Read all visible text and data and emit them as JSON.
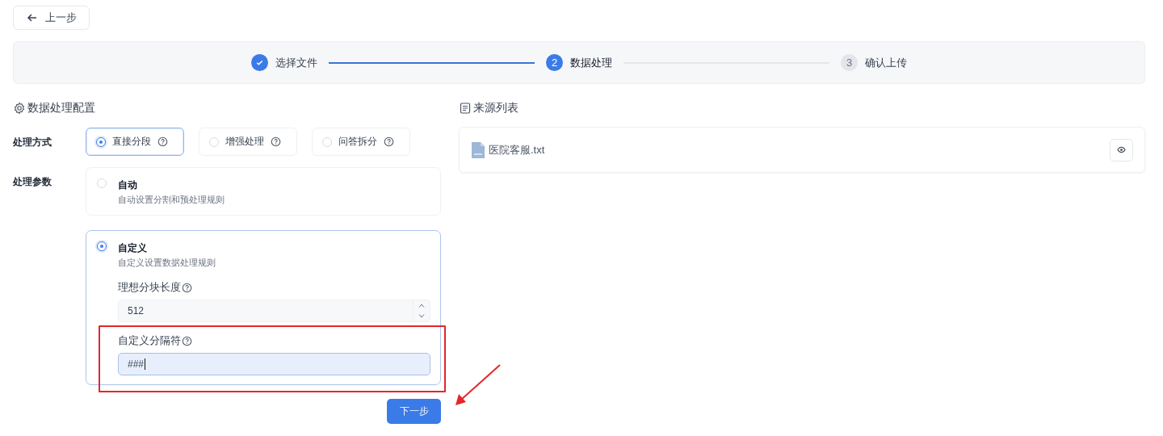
{
  "back_button": {
    "label": "上一步"
  },
  "steps": [
    {
      "label": "选择文件",
      "done": true,
      "active": false
    },
    {
      "number": "2",
      "label": "数据处理",
      "done": false,
      "active": true
    },
    {
      "number": "3",
      "label": "确认上传",
      "done": false,
      "active": false
    }
  ],
  "config": {
    "title": "数据处理配置",
    "method": {
      "label": "处理方式",
      "options": [
        {
          "label": "直接分段",
          "selected": true
        },
        {
          "label": "增强处理",
          "selected": false
        },
        {
          "label": "问答拆分",
          "selected": false
        }
      ]
    },
    "params": {
      "label": "处理参数",
      "options": [
        {
          "title": "自动",
          "description": "自动设置分割和预处理规则",
          "selected": false
        },
        {
          "title": "自定义",
          "description": "自定义设置数据处理规则",
          "selected": true,
          "fields": [
            {
              "kind": "number",
              "label": "理想分块长度",
              "value": "512",
              "focused": false
            },
            {
              "kind": "text",
              "label": "自定义分隔符",
              "value": "###",
              "focused": true,
              "highlighted": true
            }
          ]
        }
      ]
    },
    "next_button": {
      "label": "下一步",
      "pointed_at": true
    }
  },
  "sources": {
    "title": "来源列表",
    "files": [
      {
        "name": "医院客服.txt"
      }
    ]
  }
}
